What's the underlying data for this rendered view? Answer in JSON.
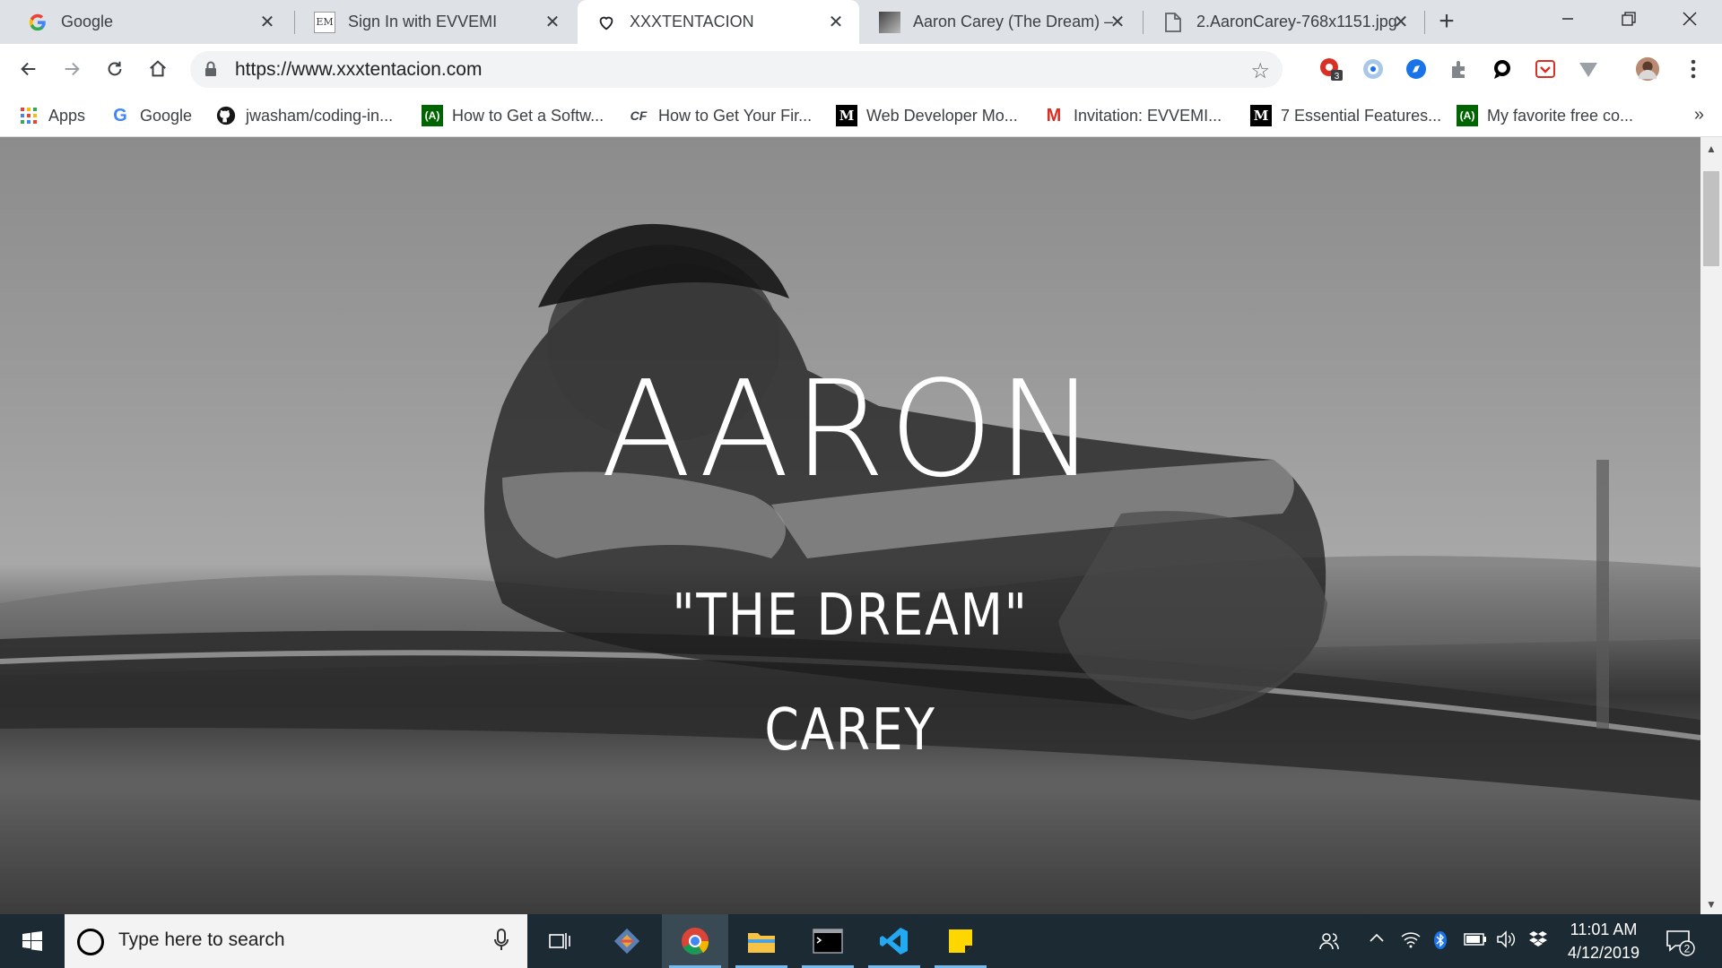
{
  "browser": {
    "tabs": [
      {
        "title": "Google",
        "favicon": "google-icon",
        "active": false
      },
      {
        "title": "Sign In with EVVEMI",
        "favicon": "evvemi-icon",
        "favicon_text": "EM",
        "active": false
      },
      {
        "title": "XXXTENTACION",
        "favicon": "heart-outline-icon",
        "active": true
      },
      {
        "title": "Aaron Carey (The Dream) –",
        "favicon": "photo-thumbnail-icon",
        "active": false
      },
      {
        "title": "2.AaronCarey-768x1151.jpg",
        "favicon": "file-icon",
        "active": false
      }
    ],
    "url": "https://www.xxxtentacion.com",
    "extension_badge": "3",
    "bookmarks": [
      {
        "label": "Apps",
        "icon": "apps-grid-icon"
      },
      {
        "label": "Google",
        "icon": "google-icon"
      },
      {
        "label": "jwasham/coding-in...",
        "icon": "github-icon"
      },
      {
        "label": "How to Get a Softw...",
        "icon": "freecodecamp-icon"
      },
      {
        "label": "How to Get Your Fir...",
        "icon": "cf-icon",
        "icon_text": "CF"
      },
      {
        "label": "Web Developer Mo...",
        "icon": "medium-icon",
        "icon_text": "M"
      },
      {
        "label": "Invitation: EVVEMI...",
        "icon": "gmail-icon",
        "icon_text": "M"
      },
      {
        "label": "7 Essential Features...",
        "icon": "medium-icon",
        "icon_text": "M"
      },
      {
        "label": "My favorite free co...",
        "icon": "freecodecamp-icon"
      }
    ],
    "bookmarks_more": "»"
  },
  "hero": {
    "first_name": "AARON",
    "nickname": "\"THE DREAM\"",
    "last_name": "CAREY"
  },
  "taskbar": {
    "search_placeholder": "Type here to search",
    "time": "11:01 AM",
    "date": "4/12/2019",
    "notification_count": "2",
    "apps": [
      "task-view-icon",
      "git-icon",
      "chrome-icon",
      "file-explorer-icon",
      "terminal-icon",
      "vscode-icon",
      "sticky-notes-icon"
    ]
  },
  "colors": {
    "tab_strip": "#dee1e6",
    "taskbar": "#1b2a33",
    "hero_text": "#ffffff",
    "accent_indicator": "#76b9ed"
  }
}
